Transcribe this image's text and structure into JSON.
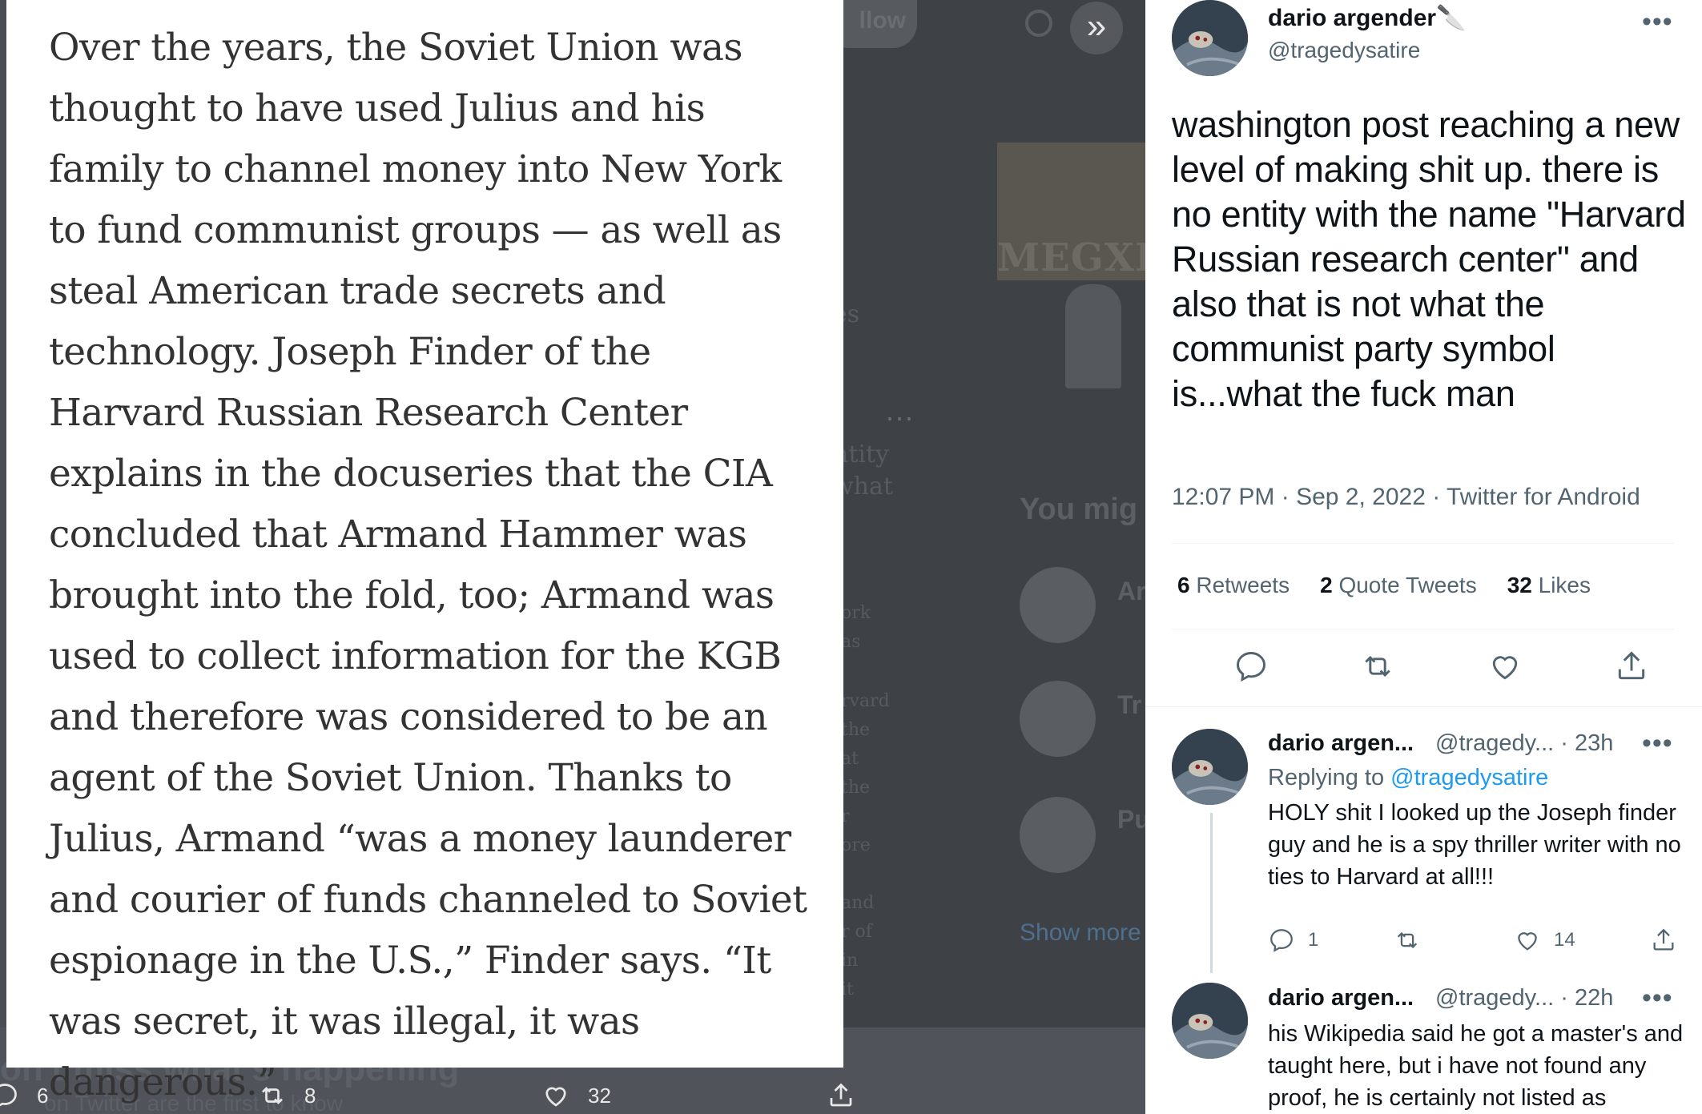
{
  "viewer": {
    "expand_icon": "chevrons-right-icon",
    "article_text": "Over the years, the Soviet Union was thought to have used Julius and his family to channel money into New York to fund communist groups — as well as steal American trade secrets and technology. Joseph Finder of the Harvard Russian Research Center explains in the docuseries that the CIA concluded that Armand Hammer was brought into the fold, too; Armand was used to collect information for the KGB and therefore was considered to be an agent of the Soviet Union. Thanks to Julius, Armand “was a money launderer and courier of funds channeled to Soviet espionage in the U.S.,” Finder says. “It was secret, it was illegal, it was dangerous.”",
    "actions": {
      "reply_count": "6",
      "retweet_count": "8",
      "like_count": "32"
    }
  },
  "tweet": {
    "author_name": "dario argender🔪",
    "author_handle": "@tragedysatire",
    "text": "washington post reaching a new level of making shit up. there is no entity with the name \"Harvard Russian research center\" and also that is not what the communist party symbol is...what the fuck man",
    "meta": "12:07 PM · Sep 2, 2022 · Twitter for Android",
    "stats": {
      "retweets_count": "6",
      "retweets_label": "Retweets",
      "quotes_count": "2",
      "quotes_label": "Quote Tweets",
      "likes_count": "32",
      "likes_label": "Likes"
    }
  },
  "replies": [
    {
      "name": "dario argen...",
      "meta": "@tragedy... · 23h",
      "replying_prefix": "Replying to",
      "replying_handle": "@tragedysatire",
      "text": "HOLY shit I looked up the Joseph finder guy and he is a spy thriller writer with no ties to Harvard at all!!!",
      "reply_count": "1",
      "like_count": "14"
    },
    {
      "name": "dario argen...",
      "meta": "@tragedy... · 22h",
      "text": "his Wikipedia said he got a master's and taught here, but i have not found any proof, he is certainly not listed as"
    }
  ],
  "colors": {
    "link_blue": "#1d9bf0",
    "text_primary": "#0f1419",
    "text_secondary": "#536471",
    "overlay": "#4a4d51"
  }
}
